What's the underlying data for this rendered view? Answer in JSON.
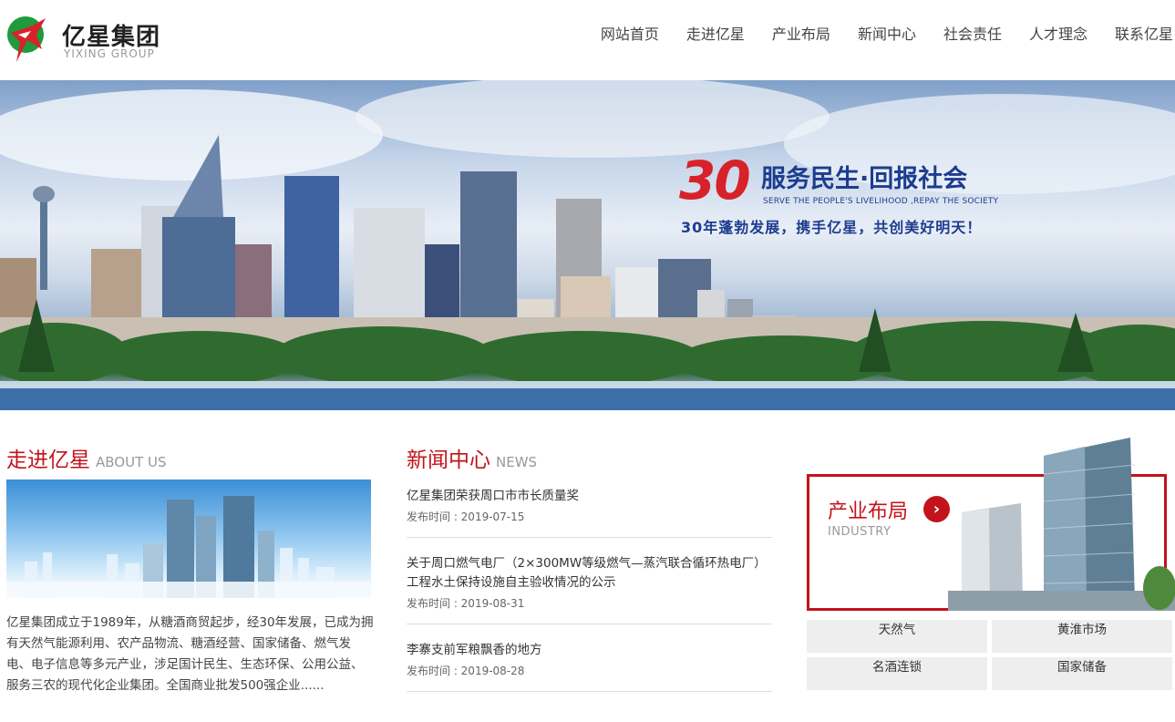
{
  "header": {
    "logo_cn": "亿星集团",
    "logo_en": "YIXING GROUP",
    "nav": [
      "网站首页",
      "走进亿星",
      "产业布局",
      "新闻中心",
      "社会责任",
      "人才理念",
      "联系亿星"
    ]
  },
  "banner": {
    "number": "30",
    "title": "服务民生·回报社会",
    "subtitle_en": "SERVE THE PEOPLE'S LIVELIHOOD ,REPAY THE SOCIETY",
    "tagline": "30年蓬勃发展，携手亿星，共创美好明天！"
  },
  "about": {
    "title_cn": "走进亿星",
    "title_en": "ABOUT US",
    "text": "亿星集团成立于1989年，从糖酒商贸起步，经30年发展，已成为拥有天然气能源利用、农产品物流、糖酒经营、国家储备、燃气发电、电子信息等多元产业，涉足国计民生、生态环保、公用公益、服务三农的现代化企业集团。全国商业批发500强企业......"
  },
  "news": {
    "title_cn": "新闻中心",
    "title_en": "NEWS",
    "items": [
      {
        "title": "亿星集团荣获周口市市长质量奖",
        "date": "发布时间 : 2019-07-15"
      },
      {
        "title": "关于周口燃气电厂（2×300MW等级燃气—蒸汽联合循环热电厂）工程水土保持设施自主验收情况的公示",
        "date": "发布时间 : 2019-08-31"
      },
      {
        "title": "李寨支前军粮飘香的地方",
        "date": "发布时间 : 2019-08-28"
      }
    ]
  },
  "industry": {
    "title_cn": "产业布局",
    "title_en": "INDUSTRY",
    "items": [
      "天然气",
      "黄淮市场",
      "名酒连锁",
      "国家储备"
    ]
  },
  "colors": {
    "brand_red": "#c2131b",
    "brand_blue": "#1d3c8f"
  }
}
